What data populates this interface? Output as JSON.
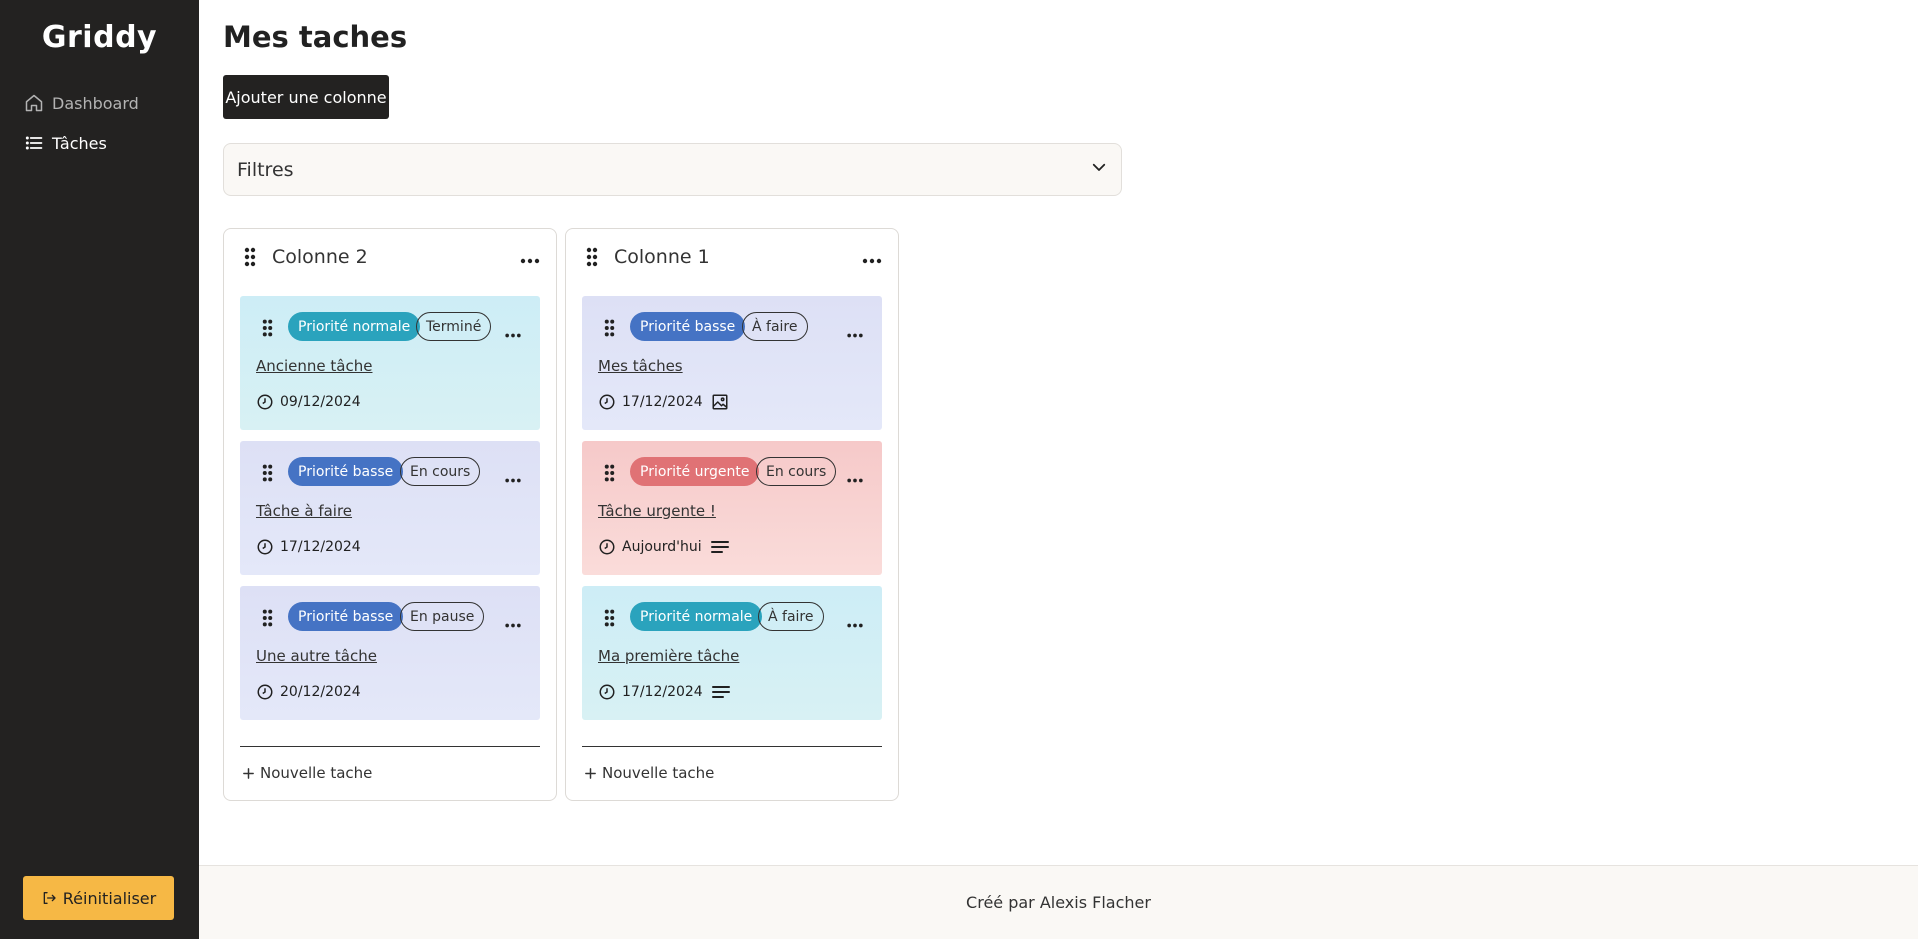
{
  "app": {
    "logo": "Griddy",
    "reset_label": "Réinitialiser"
  },
  "sidebar": {
    "items": [
      {
        "label": "Dashboard",
        "icon": "home-icon",
        "active": false
      },
      {
        "label": "Tâches",
        "icon": "list-icon",
        "active": true
      }
    ]
  },
  "main": {
    "title": "Mes taches",
    "add_column_label": "Ajouter une colonne",
    "filters_label": "Filtres"
  },
  "columns": [
    {
      "title": "Colonne 2",
      "new_task_label": "Nouvelle tache",
      "cards": [
        {
          "priority": "Priorité normale",
          "status": "Terminé",
          "title": "Ancienne tâche",
          "date": "09/12/2024"
        },
        {
          "priority": "Priorité basse",
          "status": "En cours",
          "title": "Tâche à faire",
          "date": "17/12/2024"
        },
        {
          "priority": "Priorité basse",
          "status": "En pause",
          "title": "Une autre tâche",
          "date": "20/12/2024"
        }
      ]
    },
    {
      "title": "Colonne 1",
      "new_task_label": "Nouvelle tache",
      "cards": [
        {
          "priority": "Priorité basse",
          "status": "À faire",
          "title": "Mes tâches",
          "date": "17/12/2024",
          "extra_icon": "image-icon"
        },
        {
          "priority": "Priorité urgente",
          "status": "En cours",
          "title": "Tâche urgente !",
          "date": "Aujourd'hui",
          "extra_icon": "description-icon"
        },
        {
          "priority": "Priorité normale",
          "status": "À faire",
          "title": "Ma première tâche",
          "date": "17/12/2024",
          "extra_icon": "description-icon"
        }
      ]
    }
  ],
  "footer": {
    "text": "Créé par Alexis Flacher"
  },
  "colors": {
    "sidebar_bg": "#232221",
    "accent_yellow": "#f6b845",
    "priority_normal": "#2aa3bd",
    "priority_basse": "#4573c4",
    "priority_urgente": "#e07275"
  }
}
